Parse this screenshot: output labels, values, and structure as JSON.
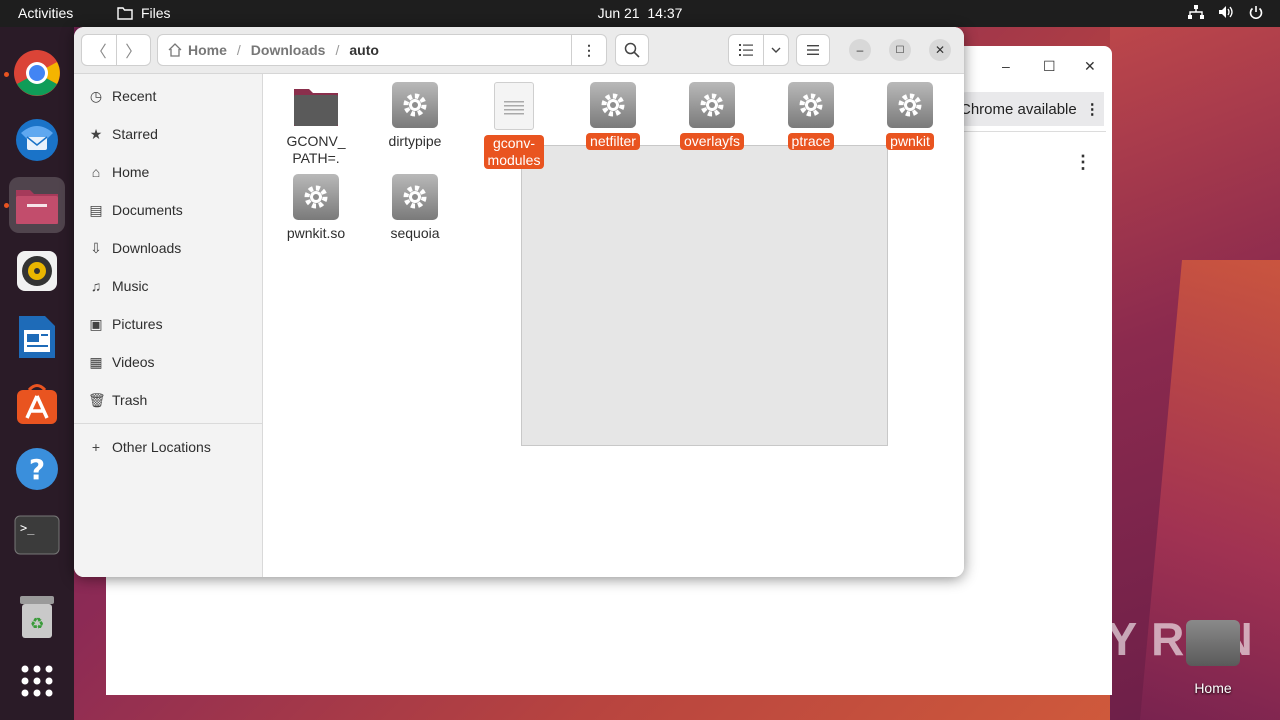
{
  "topbar": {
    "activities": "Activities",
    "app_name": "Files",
    "date": "Jun 21",
    "time": "14:37"
  },
  "dock": {
    "items": [
      {
        "name": "chrome",
        "active_dot": true
      },
      {
        "name": "thunderbird",
        "active_dot": false
      },
      {
        "name": "files",
        "active_dot": true
      },
      {
        "name": "rhythmbox",
        "active_dot": false
      },
      {
        "name": "libreoffice-writer",
        "active_dot": false
      },
      {
        "name": "app-center",
        "active_dot": false
      },
      {
        "name": "help",
        "active_dot": false
      },
      {
        "name": "terminal",
        "active_dot": false
      },
      {
        "name": "trash",
        "active_dot": false
      },
      {
        "name": "show-apps",
        "active_dot": false
      }
    ]
  },
  "chrome_window": {
    "banner_text": "Chrome available"
  },
  "files_window": {
    "path": {
      "home": "Home",
      "downloads": "Downloads",
      "current": "auto"
    },
    "sidebar": {
      "items": [
        {
          "label": "Recent",
          "icon": "clock-icon"
        },
        {
          "label": "Starred",
          "icon": "star-icon"
        },
        {
          "label": "Home",
          "icon": "home-icon"
        },
        {
          "label": "Documents",
          "icon": "document-icon"
        },
        {
          "label": "Downloads",
          "icon": "download-icon"
        },
        {
          "label": "Music",
          "icon": "music-icon"
        },
        {
          "label": "Pictures",
          "icon": "picture-icon"
        },
        {
          "label": "Videos",
          "icon": "video-icon"
        },
        {
          "label": "Trash",
          "icon": "trash-icon"
        }
      ],
      "other_locations": "Other Locations"
    },
    "files": [
      {
        "label": "GCONV_\nPATH=.",
        "type": "folder",
        "selected": false
      },
      {
        "label": "dirtypipe",
        "type": "executable",
        "selected": false
      },
      {
        "label": "gconv-\nmodules",
        "type": "text",
        "selected": true
      },
      {
        "label": "netfilter",
        "type": "executable",
        "selected": true
      },
      {
        "label": "overlayfs",
        "type": "executable",
        "selected": true
      },
      {
        "label": "ptrace",
        "type": "executable",
        "selected": true
      },
      {
        "label": "pwnkit",
        "type": "executable",
        "selected": true
      },
      {
        "label": "pwnkit.so",
        "type": "executable",
        "selected": false
      },
      {
        "label": "sequoia",
        "type": "executable",
        "selected": false
      }
    ]
  },
  "desktop": {
    "home_label": "Home",
    "watermark": "ANY RUN"
  },
  "colors": {
    "accent": "#e95420",
    "topbar": "#1e1e1e",
    "dock": "#2a1b27"
  }
}
